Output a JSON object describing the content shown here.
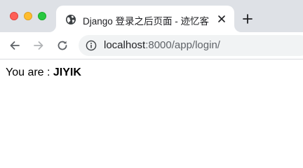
{
  "window": {
    "controls": [
      "close",
      "minimize",
      "maximize"
    ]
  },
  "tab": {
    "title": "Django 登录之后页面 - 迹忆客",
    "favicon_icon": "globe-icon",
    "close_icon": "close-icon"
  },
  "new_tab_icon": "plus-icon",
  "toolbar": {
    "back_icon": "arrow-left-icon",
    "forward_icon": "arrow-right-icon",
    "reload_icon": "reload-icon",
    "info_icon": "info-icon",
    "url_host": "localhost",
    "url_rest": ":8000/app/login/"
  },
  "page": {
    "label": "You are : ",
    "username": "JIYIK"
  },
  "colors": {
    "tabstrip_bg": "#dee1e6",
    "omnibox_bg": "#f1f3f4",
    "traffic_close": "#fe5f57",
    "traffic_min": "#febc2e",
    "traffic_max": "#28c840"
  }
}
